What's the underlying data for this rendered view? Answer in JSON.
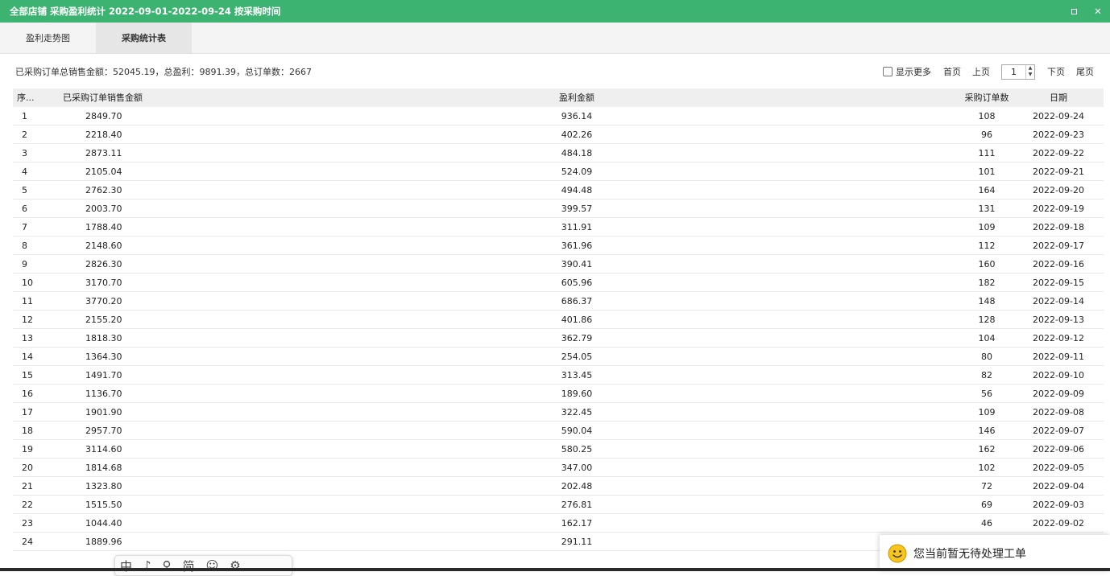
{
  "window": {
    "title": "全部店铺 采购盈利统计 2022-09-01-2022-09-24 按采购时间",
    "restore_symbol": "",
    "close_symbol": "✕"
  },
  "tabs": [
    {
      "label": "盈利走势图",
      "active": false
    },
    {
      "label": "采购统计表",
      "active": true
    }
  ],
  "summary": "已采购订单总销售金额：52045.19，总盈利：9891.39，总订单数：2667",
  "pager": {
    "show_more_label": "显示更多",
    "show_more_checked": false,
    "first": "首页",
    "prev": "上页",
    "page": "1",
    "next": "下页",
    "last": "尾页"
  },
  "table": {
    "headers": {
      "idx": "序...",
      "sales": "已采购订单销售金额",
      "profit": "盈利金额",
      "count": "采购订单数",
      "date": "日期"
    },
    "rows": [
      {
        "idx": "1",
        "sales": "2849.70",
        "profit": "936.14",
        "count": "108",
        "date": "2022-09-24"
      },
      {
        "idx": "2",
        "sales": "2218.40",
        "profit": "402.26",
        "count": "96",
        "date": "2022-09-23"
      },
      {
        "idx": "3",
        "sales": "2873.11",
        "profit": "484.18",
        "count": "111",
        "date": "2022-09-22"
      },
      {
        "idx": "4",
        "sales": "2105.04",
        "profit": "524.09",
        "count": "101",
        "date": "2022-09-21"
      },
      {
        "idx": "5",
        "sales": "2762.30",
        "profit": "494.48",
        "count": "164",
        "date": "2022-09-20"
      },
      {
        "idx": "6",
        "sales": "2003.70",
        "profit": "399.57",
        "count": "131",
        "date": "2022-09-19"
      },
      {
        "idx": "7",
        "sales": "1788.40",
        "profit": "311.91",
        "count": "109",
        "date": "2022-09-18"
      },
      {
        "idx": "8",
        "sales": "2148.60",
        "profit": "361.96",
        "count": "112",
        "date": "2022-09-17"
      },
      {
        "idx": "9",
        "sales": "2826.30",
        "profit": "390.41",
        "count": "160",
        "date": "2022-09-16"
      },
      {
        "idx": "10",
        "sales": "3170.70",
        "profit": "605.96",
        "count": "182",
        "date": "2022-09-15"
      },
      {
        "idx": "11",
        "sales": "3770.20",
        "profit": "686.37",
        "count": "148",
        "date": "2022-09-14"
      },
      {
        "idx": "12",
        "sales": "2155.20",
        "profit": "401.86",
        "count": "128",
        "date": "2022-09-13"
      },
      {
        "idx": "13",
        "sales": "1818.30",
        "profit": "362.79",
        "count": "104",
        "date": "2022-09-12"
      },
      {
        "idx": "14",
        "sales": "1364.30",
        "profit": "254.05",
        "count": "80",
        "date": "2022-09-11"
      },
      {
        "idx": "15",
        "sales": "1491.70",
        "profit": "313.45",
        "count": "82",
        "date": "2022-09-10"
      },
      {
        "idx": "16",
        "sales": "1136.70",
        "profit": "189.60",
        "count": "56",
        "date": "2022-09-09"
      },
      {
        "idx": "17",
        "sales": "1901.90",
        "profit": "322.45",
        "count": "109",
        "date": "2022-09-08"
      },
      {
        "idx": "18",
        "sales": "2957.70",
        "profit": "590.04",
        "count": "146",
        "date": "2022-09-07"
      },
      {
        "idx": "19",
        "sales": "3114.60",
        "profit": "580.25",
        "count": "162",
        "date": "2022-09-06"
      },
      {
        "idx": "20",
        "sales": "1814.68",
        "profit": "347.00",
        "count": "102",
        "date": "2022-09-05"
      },
      {
        "idx": "21",
        "sales": "1323.80",
        "profit": "202.48",
        "count": "72",
        "date": "2022-09-04"
      },
      {
        "idx": "22",
        "sales": "1515.50",
        "profit": "276.81",
        "count": "69",
        "date": "2022-09-03"
      },
      {
        "idx": "23",
        "sales": "1044.40",
        "profit": "162.17",
        "count": "46",
        "date": "2022-09-02"
      },
      {
        "idx": "24",
        "sales": "1889.96",
        "profit": "291.11",
        "count": "",
        "date": ""
      }
    ]
  },
  "ime_toolbar": {
    "items": [
      "中",
      "♪",
      "⚲",
      "简",
      "☺",
      "⚙"
    ]
  },
  "notification": {
    "text": "您当前暂无待处理工单",
    "icon": "smiley-icon"
  }
}
